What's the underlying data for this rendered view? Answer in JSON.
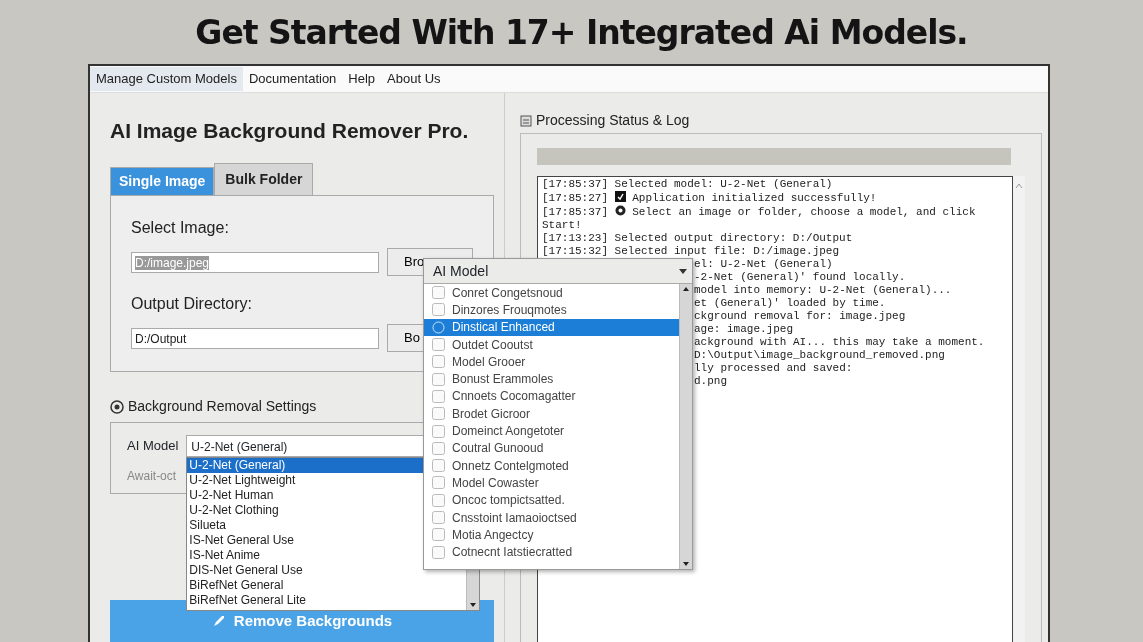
{
  "headline": "Get Started With 17+ Integrated Ai Models.",
  "menu": [
    {
      "label": "Manage Custom Models",
      "selected": true
    },
    {
      "label": "Documentation",
      "selected": false
    },
    {
      "label": "Help",
      "selected": false
    },
    {
      "label": "About Us",
      "selected": false
    }
  ],
  "app_title": "AI Image Background Remover Pro.",
  "tabs": [
    {
      "label": "Single Image",
      "selected": true
    },
    {
      "label": "Bulk Folder",
      "selected": false
    }
  ],
  "select_image": {
    "label": "Select Image:",
    "value": "D:/image.jpeg",
    "button": "Bro"
  },
  "output_directory": {
    "label": "Output Directory:",
    "value": "D:/Output",
    "button": "Bo"
  },
  "settings": {
    "title": "Background Removal Settings",
    "model_label": "AI Model",
    "model_value": "U-2-Net (General)",
    "note": "Await-oct",
    "model_options": [
      {
        "label": "U-2-Net (General)",
        "selected": true
      },
      {
        "label": "U-2-Net Lightweight",
        "selected": false
      },
      {
        "label": "U-2-Net Human",
        "selected": false
      },
      {
        "label": "U-2-Net Clothing",
        "selected": false
      },
      {
        "label": "Silueta",
        "selected": false
      },
      {
        "label": "IS-Net General Use",
        "selected": false
      },
      {
        "label": "IS-Net Anime",
        "selected": false
      },
      {
        "label": "DIS-Net General Use",
        "selected": false
      },
      {
        "label": "BiRefNet General",
        "selected": false
      },
      {
        "label": "BiRefNet General Lite",
        "selected": false
      }
    ]
  },
  "remove_button": "Remove Backgrounds",
  "log_panel": {
    "title": "Processing Status & Log",
    "lines": [
      {
        "text": "[17:85:37] Selected model: U-2-Net (General)"
      },
      {
        "text": "[17:85:27] ",
        "kind": "check",
        "after": "Application initialized successfully!"
      },
      {
        "text": "[17:85:37] ",
        "kind": "info",
        "after": "Select an image or folder, choose a model, and click"
      },
      {
        "text": "Start!"
      },
      {
        "text": "[17:13:23] Selected output directory: D:/Output"
      },
      {
        "text": "[17:15:32] Selected input file: D:/image.jpeg"
      }
    ],
    "lines_behind_popup": [
      "el: U-2-Net (General)",
      "-2-Net (General)' found locally.",
      "model into memory: U-2-Net (General)...",
      "et (General)' loaded by time.",
      "ckground removal for: image.jpeg",
      "age: image.jpeg",
      "ackground with AI... this may take a moment.",
      "D:\\Output\\image_background_removed.png",
      "lly processed and saved:",
      "d.png"
    ]
  },
  "model_popup": {
    "title": "AI Model",
    "items": [
      {
        "label": "Conret Congetsnoud",
        "selected": false,
        "checked": false
      },
      {
        "label": "Dinzores Frouqmotes",
        "selected": false,
        "checked": false
      },
      {
        "label": "Dinstical Enhanced",
        "selected": true,
        "checked": false
      },
      {
        "label": "Outdet Cooutst",
        "selected": false,
        "checked": false
      },
      {
        "label": "Model Grooer",
        "selected": false,
        "checked": false
      },
      {
        "label": "Bonust Erammoles",
        "selected": false,
        "checked": false
      },
      {
        "label": "Cnnoets Cocomagatter",
        "selected": false,
        "checked": false
      },
      {
        "label": "Brodet Gicroor",
        "selected": false,
        "checked": false
      },
      {
        "label": "Domeinct Aongetoter",
        "selected": false,
        "checked": false
      },
      {
        "label": "Coutral Gunooud",
        "selected": false,
        "checked": false
      },
      {
        "label": "Onnetz Contelgmoted",
        "selected": false,
        "checked": false
      },
      {
        "label": "Model Cowaster",
        "selected": false,
        "checked": false
      },
      {
        "label": "Oncoc tompictsatted.",
        "selected": false,
        "checked": false
      },
      {
        "label": "Cnsstoint Iamaoioctsed",
        "selected": false,
        "checked": false
      },
      {
        "label": "Motia Angectcy",
        "selected": false,
        "checked": false
      },
      {
        "label": "Cotnecnt Iatstiecratted",
        "selected": false,
        "checked": false
      }
    ]
  }
}
